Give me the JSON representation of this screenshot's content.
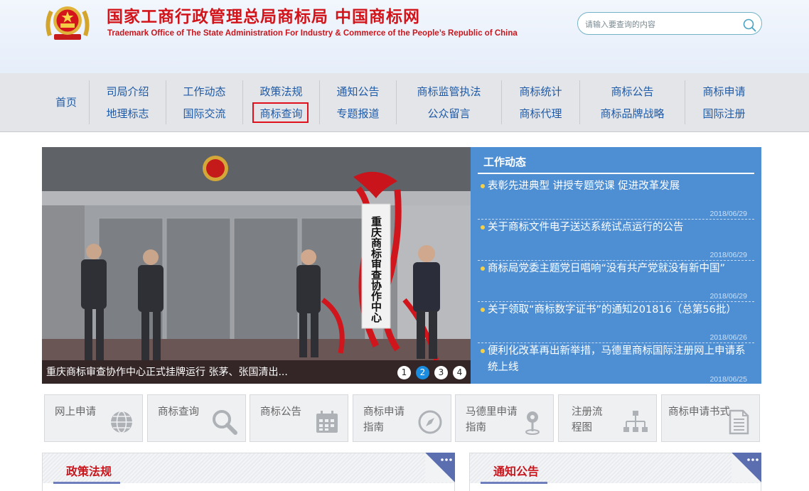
{
  "header": {
    "title_cn": "国家工商行政管理总局商标局  中国商标网",
    "title_en": "Trademark Office of The State Administration For Industry & Commerce of the People’s Republic of China",
    "search": {
      "placeholder": "请输入要查询的内容"
    }
  },
  "nav": {
    "home": "首页",
    "columns": [
      {
        "top": "司局介绍",
        "bottom": "地理标志"
      },
      {
        "top": "工作动态",
        "bottom": "国际交流"
      },
      {
        "top": "政策法规",
        "bottom": "商标查询"
      },
      {
        "top": "通知公告",
        "bottom": "专题报道"
      },
      {
        "top": "商标监管执法",
        "bottom": "公众留言"
      },
      {
        "top": "商标统计",
        "bottom": "商标代理"
      },
      {
        "top": "商标公告",
        "bottom": "商标品牌战略"
      },
      {
        "top": "商标申请",
        "bottom": "国际注册"
      }
    ],
    "highlighted": "商标查询"
  },
  "banner": {
    "sign_text": "重庆商标审查协作中心",
    "caption": "重庆商标审查协作中心正式挂牌运行 张茅、张国清出...",
    "dots": [
      "1",
      "2",
      "3",
      "4"
    ],
    "active_dot": 2
  },
  "news": {
    "title": "工作动态",
    "items": [
      {
        "text": "表彰先进典型 讲授专题党课 促进改革发展",
        "date": "2018/06/29"
      },
      {
        "text": "关于商标文件电子送达系统试点运行的公告",
        "date": "2018/06/29"
      },
      {
        "text": "商标局党委主题党日唱响“没有共产党就没有新中国”",
        "date": "2018/06/29"
      },
      {
        "text": "关于领取“商标数字证书”的通知201816（总第56批）",
        "date": "2018/06/26"
      },
      {
        "text": "便利化改革再出新举措，马德里商标国际注册网上申请系统上线",
        "date": "2018/06/25"
      }
    ]
  },
  "tiles": [
    {
      "label": "网上申请",
      "icon": "globe-icon"
    },
    {
      "label": "商标查询",
      "icon": "magnifier-icon"
    },
    {
      "label": "商标公告",
      "icon": "calendar-icon"
    },
    {
      "label": "商标申请指南",
      "icon": "compass-icon"
    },
    {
      "label": "马德里申请指南",
      "icon": "map-pin-icon"
    },
    {
      "label": "注册流程图",
      "icon": "flowchart-icon"
    },
    {
      "label": "商标申请书式",
      "icon": "document-icon"
    }
  ],
  "sections": {
    "policy_title": "政策法规",
    "notice_title": "通知公告"
  },
  "colors": {
    "brand_red": "#d2141a",
    "nav_blue": "#1e5aa8",
    "panel_blue": "#4e8fd4",
    "dot_active": "#1a8de0"
  }
}
